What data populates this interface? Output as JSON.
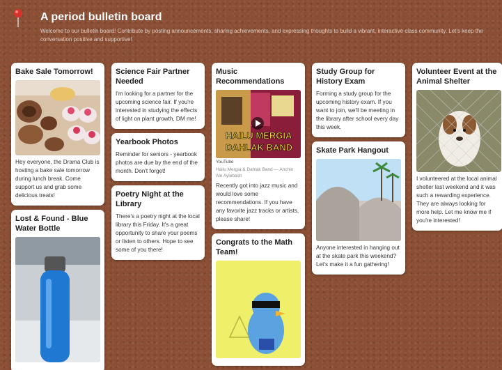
{
  "header": {
    "title": "A period bulletin board",
    "description": "Welcome to our bulletin board! Contribute by posting announcements, sharing achievements, and expressing thoughts to build a vibrant, interactive class community. Let's keep the conversation positive and supportive!"
  },
  "cards": {
    "bake_sale": {
      "title": "Bake Sale Tomorrow!",
      "body": "Hey everyone, the Drama Club is hosting a bake sale tomorrow during lunch break. Come support us and grab some delicious treats!"
    },
    "lost_found": {
      "title": "Lost & Found - Blue Water Bottle"
    },
    "science_fair": {
      "title": "Science Fair Partner Needed",
      "body": "I'm looking for a partner for the upcoming science fair. If you're interested in studying the effects of light on plant growth, DM me!"
    },
    "yearbook": {
      "title": "Yearbook Photos",
      "body": "Reminder for seniors - yearbook photos are due by the end of the month. Don't forget!"
    },
    "poetry": {
      "title": "Poetry Night at the Library",
      "body": "There's a poetry night at the local library this Friday. It's a great opportunity to share your poems or listen to others. Hope to see some of you there!"
    },
    "music": {
      "title": "Music Recommendations",
      "video_text_line1": "HAILU MERGIA",
      "video_text_line2": "DAHLAK BAND",
      "source": "YouTube",
      "meta": "Hailu Mergia & Dahlak Band — Anchin Alo Aylebash",
      "body": "Recently got into jazz music and would love some recommendations. If you have any favorite jazz tracks or artists, please share!"
    },
    "math_team": {
      "title": "Congrats to the Math Team!"
    },
    "study_group": {
      "title": "Study Group for History Exam",
      "body": "Forming a study group for the upcoming history exam. If you want to join, we'll be meeting in the library after school every day this week."
    },
    "skate_park": {
      "title": "Skate Park Hangout",
      "body": "Anyone interested in hanging out at the skate park this weekend? Let's make it a fun gathering!"
    },
    "volunteer": {
      "title": "Volunteer Event at the Animal Shelter",
      "body": "I volunteered at the local animal shelter last weekend and it was such a rewarding experience. They are always looking for more help. Let me know me if you're interested!"
    }
  },
  "colors": {
    "board": "#8a4f34",
    "pin": "#d9342b",
    "card": "#ffffff"
  }
}
